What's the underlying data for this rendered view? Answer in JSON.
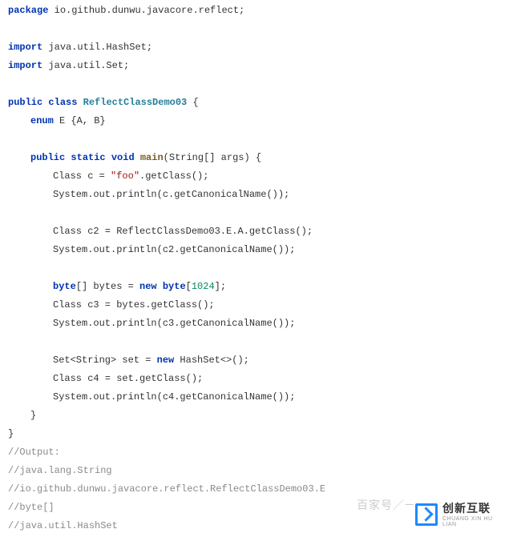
{
  "package_kw": "package",
  "package_name": " io.github.dunwu.javacore.reflect;",
  "import_kw": "import",
  "import1": " java.util.HashSet;",
  "import2": " java.util.Set;",
  "public_kw": "public",
  "class_kw": "class",
  "class_name": "ReflectClassDemo03",
  "brace_open": " {",
  "enum_kw": "enum",
  "enum_decl": " E {A, B}",
  "static_kw": "static",
  "void_kw": "void",
  "main_name": "main",
  "main_args": "(String[] args) {",
  "l1a": "Class c = ",
  "foo_str": "\"foo\"",
  "l1b": ".getClass();",
  "l2": "System.out.println(c.getCanonicalName());",
  "l3": "Class c2 = ReflectClassDemo03.E.A.getClass();",
  "l4": "System.out.println(c2.getCanonicalName());",
  "byte_kw": "byte",
  "l5a": "[] bytes = ",
  "new_kw": "new",
  "l5b": " byte",
  "l5c": "[",
  "num1024": "1024",
  "l5d": "];",
  "l6": "Class c3 = bytes.getClass();",
  "l7": "System.out.println(c3.getCanonicalName());",
  "l8a": "Set<String> set = ",
  "l8b": " HashSet<>();",
  "l9": "Class c4 = set.getClass();",
  "l10": "System.out.println(c4.getCanonicalName());",
  "close_brace": "}",
  "c_out": "//Output:",
  "c_1": "//java.lang.String",
  "c_2": "//io.github.dunwu.javacore.reflect.ReflectClassDemo03.E",
  "c_3": "//byte[]",
  "c_4": "//java.util.HashSet",
  "watermark": "百家号／一",
  "logo_cn": "创新互联",
  "logo_en": "CHUANG XIN HU LIAN"
}
